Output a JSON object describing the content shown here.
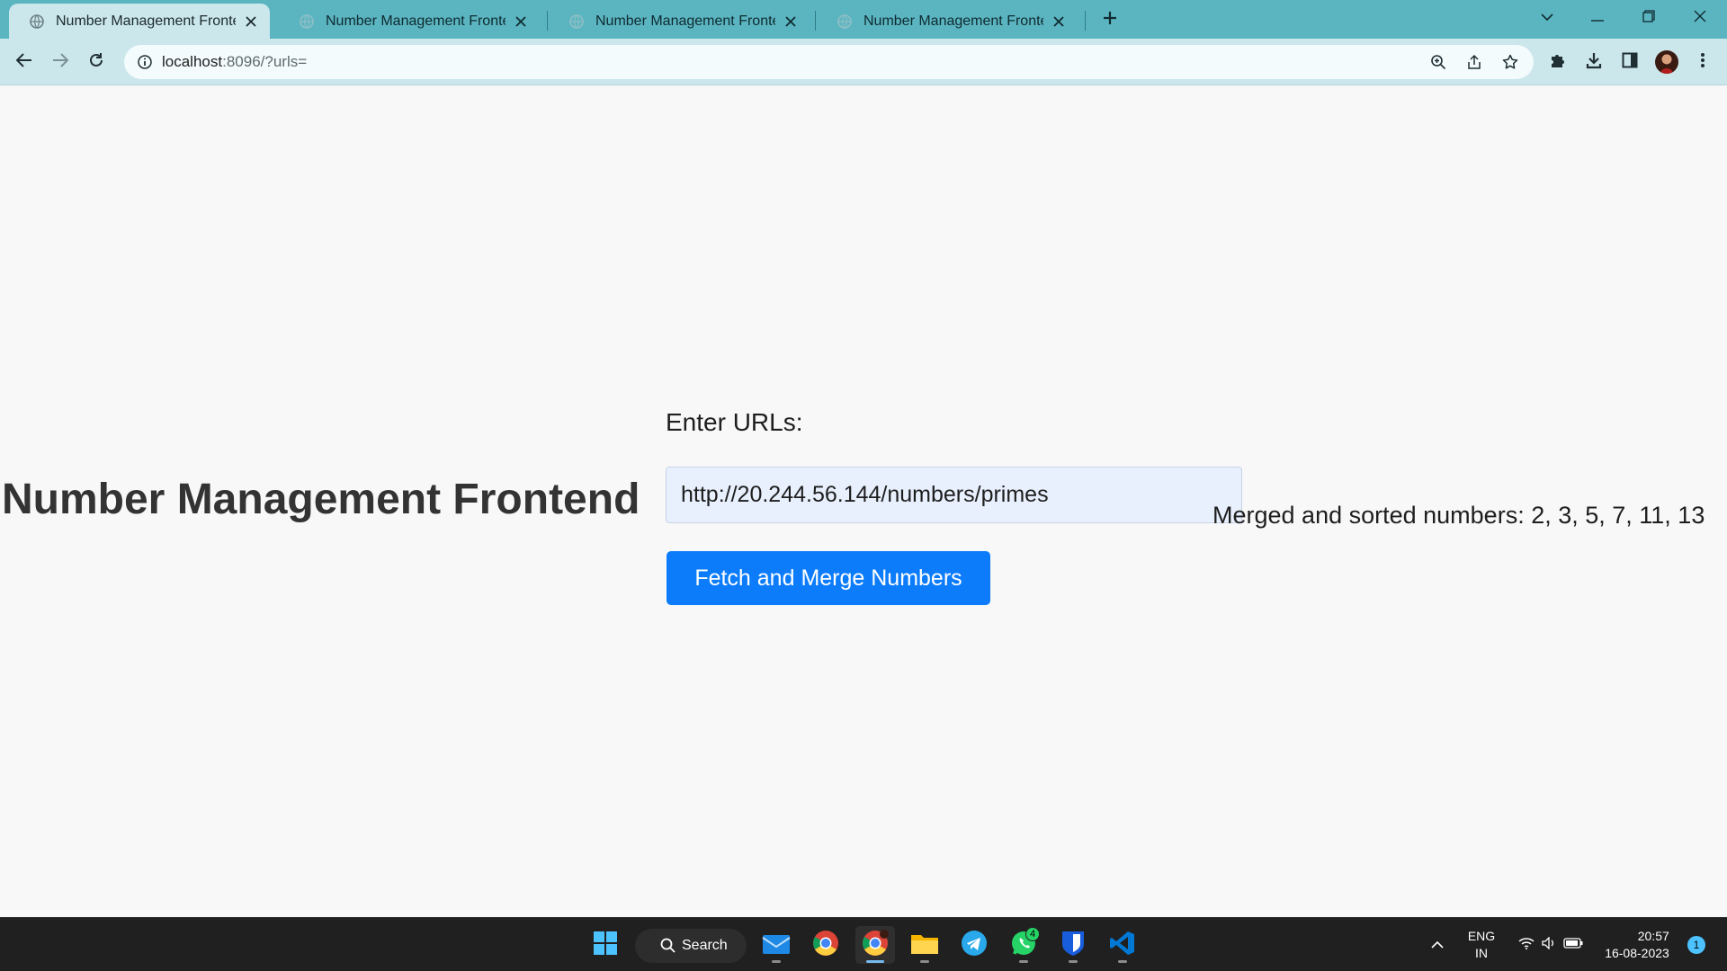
{
  "browser": {
    "tabs": [
      {
        "title": "Number Management Frontend",
        "active": true
      },
      {
        "title": "Number Management Frontend",
        "active": false
      },
      {
        "title": "Number Management Frontend",
        "active": false
      },
      {
        "title": "Number Management Frontend",
        "active": false
      }
    ],
    "address": {
      "host": "localhost",
      "path": ":8096/?urls="
    }
  },
  "page": {
    "heading": "Number Management Frontend",
    "url_label": "Enter URLs:",
    "url_value": "http://20.244.56.144/numbers/primes",
    "button_label": "Fetch and Merge Numbers",
    "result_text": "Merged and sorted numbers: 2, 3, 5, 7, 11, 13"
  },
  "taskbar": {
    "search_label": "Search",
    "apps": [
      "windows-start",
      "mail",
      "chrome",
      "chrome-dev",
      "file-explorer",
      "telegram",
      "whatsapp",
      "bitwarden",
      "vscode"
    ],
    "whatsapp_badge": "4",
    "language_line1": "ENG",
    "language_line2": "IN",
    "time": "20:57",
    "date": "16-08-2023",
    "notification_count": "1"
  },
  "colors": {
    "titlebar": "#5bb5c1",
    "toolbar": "#cbe7ec",
    "button": "#0c7cfb",
    "taskbar": "#202020"
  }
}
